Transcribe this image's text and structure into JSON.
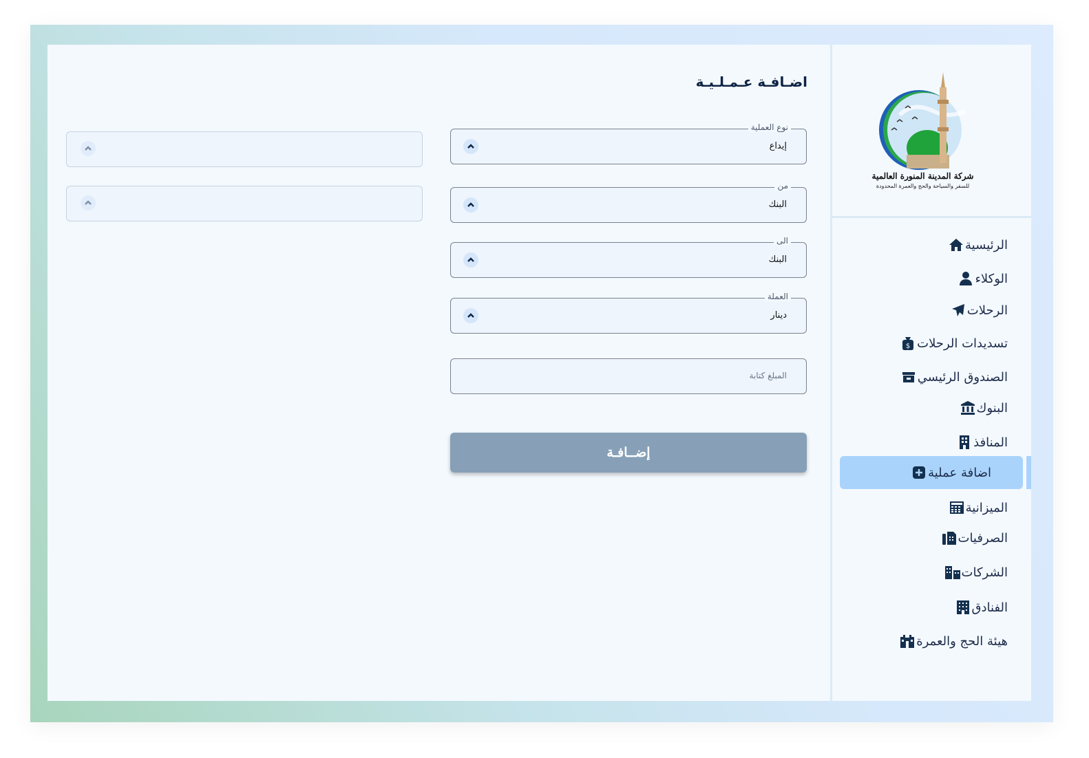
{
  "logo": {
    "title": "شركة المدينة المنورة العالمية",
    "subtitle": "للسفر والسياحة والحج والعمرة المحدودة"
  },
  "sidebar": {
    "items": [
      {
        "label": "الرئيسية",
        "icon": "home-icon"
      },
      {
        "label": "الوكلاء",
        "icon": "user-tie-icon"
      },
      {
        "label": "الرحلات",
        "icon": "plane-icon"
      },
      {
        "label": "تسديدات الرحلات",
        "icon": "money-bag-icon"
      },
      {
        "label": "الصندوق الرئيسي",
        "icon": "cash-box-icon"
      },
      {
        "label": "البنوك",
        "icon": "bank-icon"
      },
      {
        "label": "المنافذ",
        "icon": "building-icon"
      },
      {
        "label": "اضافة عملية",
        "icon": "plus-square-icon",
        "active": true
      },
      {
        "label": "الميزانية",
        "icon": "calculator-icon"
      },
      {
        "label": "الصرفيات",
        "icon": "fax-icon"
      },
      {
        "label": "الشركات",
        "icon": "buildings-icon"
      },
      {
        "label": "الفنادق",
        "icon": "hotel-icon"
      },
      {
        "label": "هيئة الحج والعمرة",
        "icon": "kaaba-icon"
      }
    ]
  },
  "main": {
    "title": "اضـافـة عـمـلـيـة",
    "fields": {
      "operation_type": {
        "label": "نوع العملية",
        "value": "إيداع"
      },
      "from": {
        "label": "من",
        "value": "البنك"
      },
      "to": {
        "label": "الى",
        "value": "البنك"
      },
      "currency": {
        "label": "العملة",
        "value": "دينار"
      },
      "amount": {
        "placeholder": "المبلغ كتابة"
      }
    },
    "submit_label": "إضــافـة"
  },
  "colors": {
    "accent": "#a9d3fb",
    "button": "#87a0b7",
    "text_dark": "#0e2444"
  }
}
